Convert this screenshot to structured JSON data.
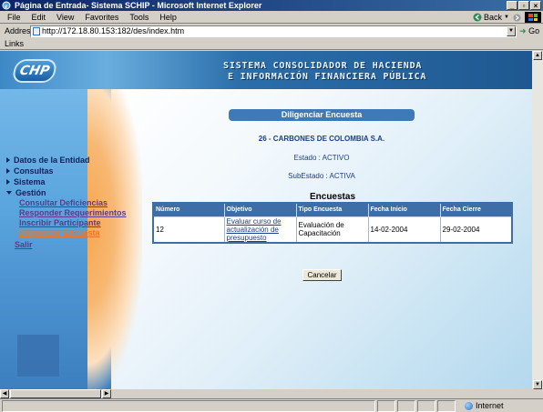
{
  "window": {
    "title": "Página de Entrada- Sistema SCHIP - Microsoft Internet Explorer",
    "minimize": "_",
    "maximize": "▫",
    "close": "×"
  },
  "menubar": {
    "items": [
      "File",
      "Edit",
      "View",
      "Favorites",
      "Tools",
      "Help"
    ],
    "back_label": "Back",
    "forward_label": "›"
  },
  "address": {
    "label": "Address",
    "url": "http://172.18.80.153:182/des/index.htm",
    "go_label": "Go"
  },
  "links": {
    "label": "Links"
  },
  "header": {
    "logo_text": "CHP",
    "brand_line1": "SISTEMA CONSOLIDADOR DE HACIENDA",
    "brand_line2": "E INFORMACIÓN FINANCIERA PÚBLICA"
  },
  "sidebar": {
    "main_items": [
      "Datos de la Entidad",
      "Consultas",
      "Sistema",
      "Gestión"
    ],
    "sub_items": [
      "Consultar Deficiencias",
      "Responder Requerimientos",
      "Inscribir Participante",
      "Diligenciar Encuesta"
    ],
    "exit_label": "Salir"
  },
  "main": {
    "section_title": "Diligenciar Encuesta",
    "entity": "26 - CARBONES DE COLOMBIA S.A.",
    "estado": "Estado : ACTIVO",
    "subestado": "SubEstado : ACTIVA",
    "surveys_title": "Encuestas",
    "table": {
      "headers": [
        "Número",
        "Objetivo",
        "Tipo Encuesta",
        "Fecha Inicio",
        "Fecha Cierre"
      ],
      "rows": [
        {
          "numero": "12",
          "objetivo": "Evaluar curso de actualización de presupuesto",
          "tipo": "Evaluación de Capacitación",
          "inicio": "14-02-2004",
          "cierre": "29-02-2004"
        }
      ]
    },
    "cancel_label": "Cancelar"
  },
  "statusbar": {
    "zone": "Internet"
  },
  "colors": {
    "titlebar": "#0a246a",
    "header": "#2b6eaa",
    "accent_orange": "#f8a64e",
    "table_header": "#3e6ea5"
  }
}
